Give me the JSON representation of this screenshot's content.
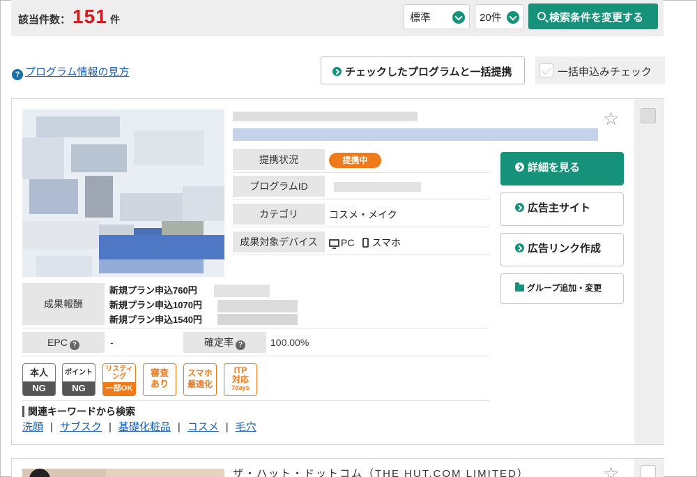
{
  "result_bar": {
    "count_label": "該当件数：",
    "count": "151",
    "count_unit": "件",
    "sort_select": "標準",
    "per_page_select": "20件",
    "search_button": "検索条件を変更する"
  },
  "toolbar": {
    "help_link": "プログラム情報の見方",
    "bulk_button": "チェックしたプログラムと一括提携",
    "bulk_check_label": "一括申込みチェック"
  },
  "program": {
    "rows": [
      {
        "label": "提携状況",
        "badge": "提携中"
      },
      {
        "label": "プログラムID",
        "value": ""
      },
      {
        "label": "カテゴリ",
        "value": "コスメ・メイク"
      },
      {
        "label": "成果対象デバイス",
        "pc": "PC",
        "sp": "スマホ"
      }
    ],
    "actions": {
      "details": "詳細を見る",
      "advertiser_site": "広告主サイト",
      "create_link": "広告リンク作成",
      "group": "グループ追加・変更"
    },
    "reward_label": "成果報酬",
    "rewards": [
      "新規プラン申込760円",
      "新規プラン申込1070円",
      "新規プラン申込1540円"
    ],
    "epc_label": "EPC",
    "epc_value": "-",
    "approval_label": "確定率",
    "approval_value": "100.00%",
    "tags": [
      {
        "top": "本人",
        "bottom": "NG"
      },
      {
        "top": "ポイント",
        "bottom": "NG"
      },
      {
        "top": "リスティング",
        "bottom": "一部OK"
      },
      {
        "top": "審査",
        "bottom": "あり"
      },
      {
        "top": "スマホ",
        "bottom": "最適化"
      },
      {
        "top": "ITP",
        "mid": "対応",
        "bottom": "7days"
      }
    ],
    "keyword_title": "関連キーワードから検索",
    "keywords": [
      "洗顔",
      "サブスク",
      "基礎化粧品",
      "コスメ",
      "毛穴"
    ]
  },
  "next_program": {
    "title": "ザ・ハット・ドットコム（THE HUT.COM LIMITED）"
  },
  "colors": {
    "accent_green": "#16927a",
    "count_red": "#d01d1d",
    "badge_orange": "#f07a1a",
    "link_blue": "#1a5fb4"
  }
}
